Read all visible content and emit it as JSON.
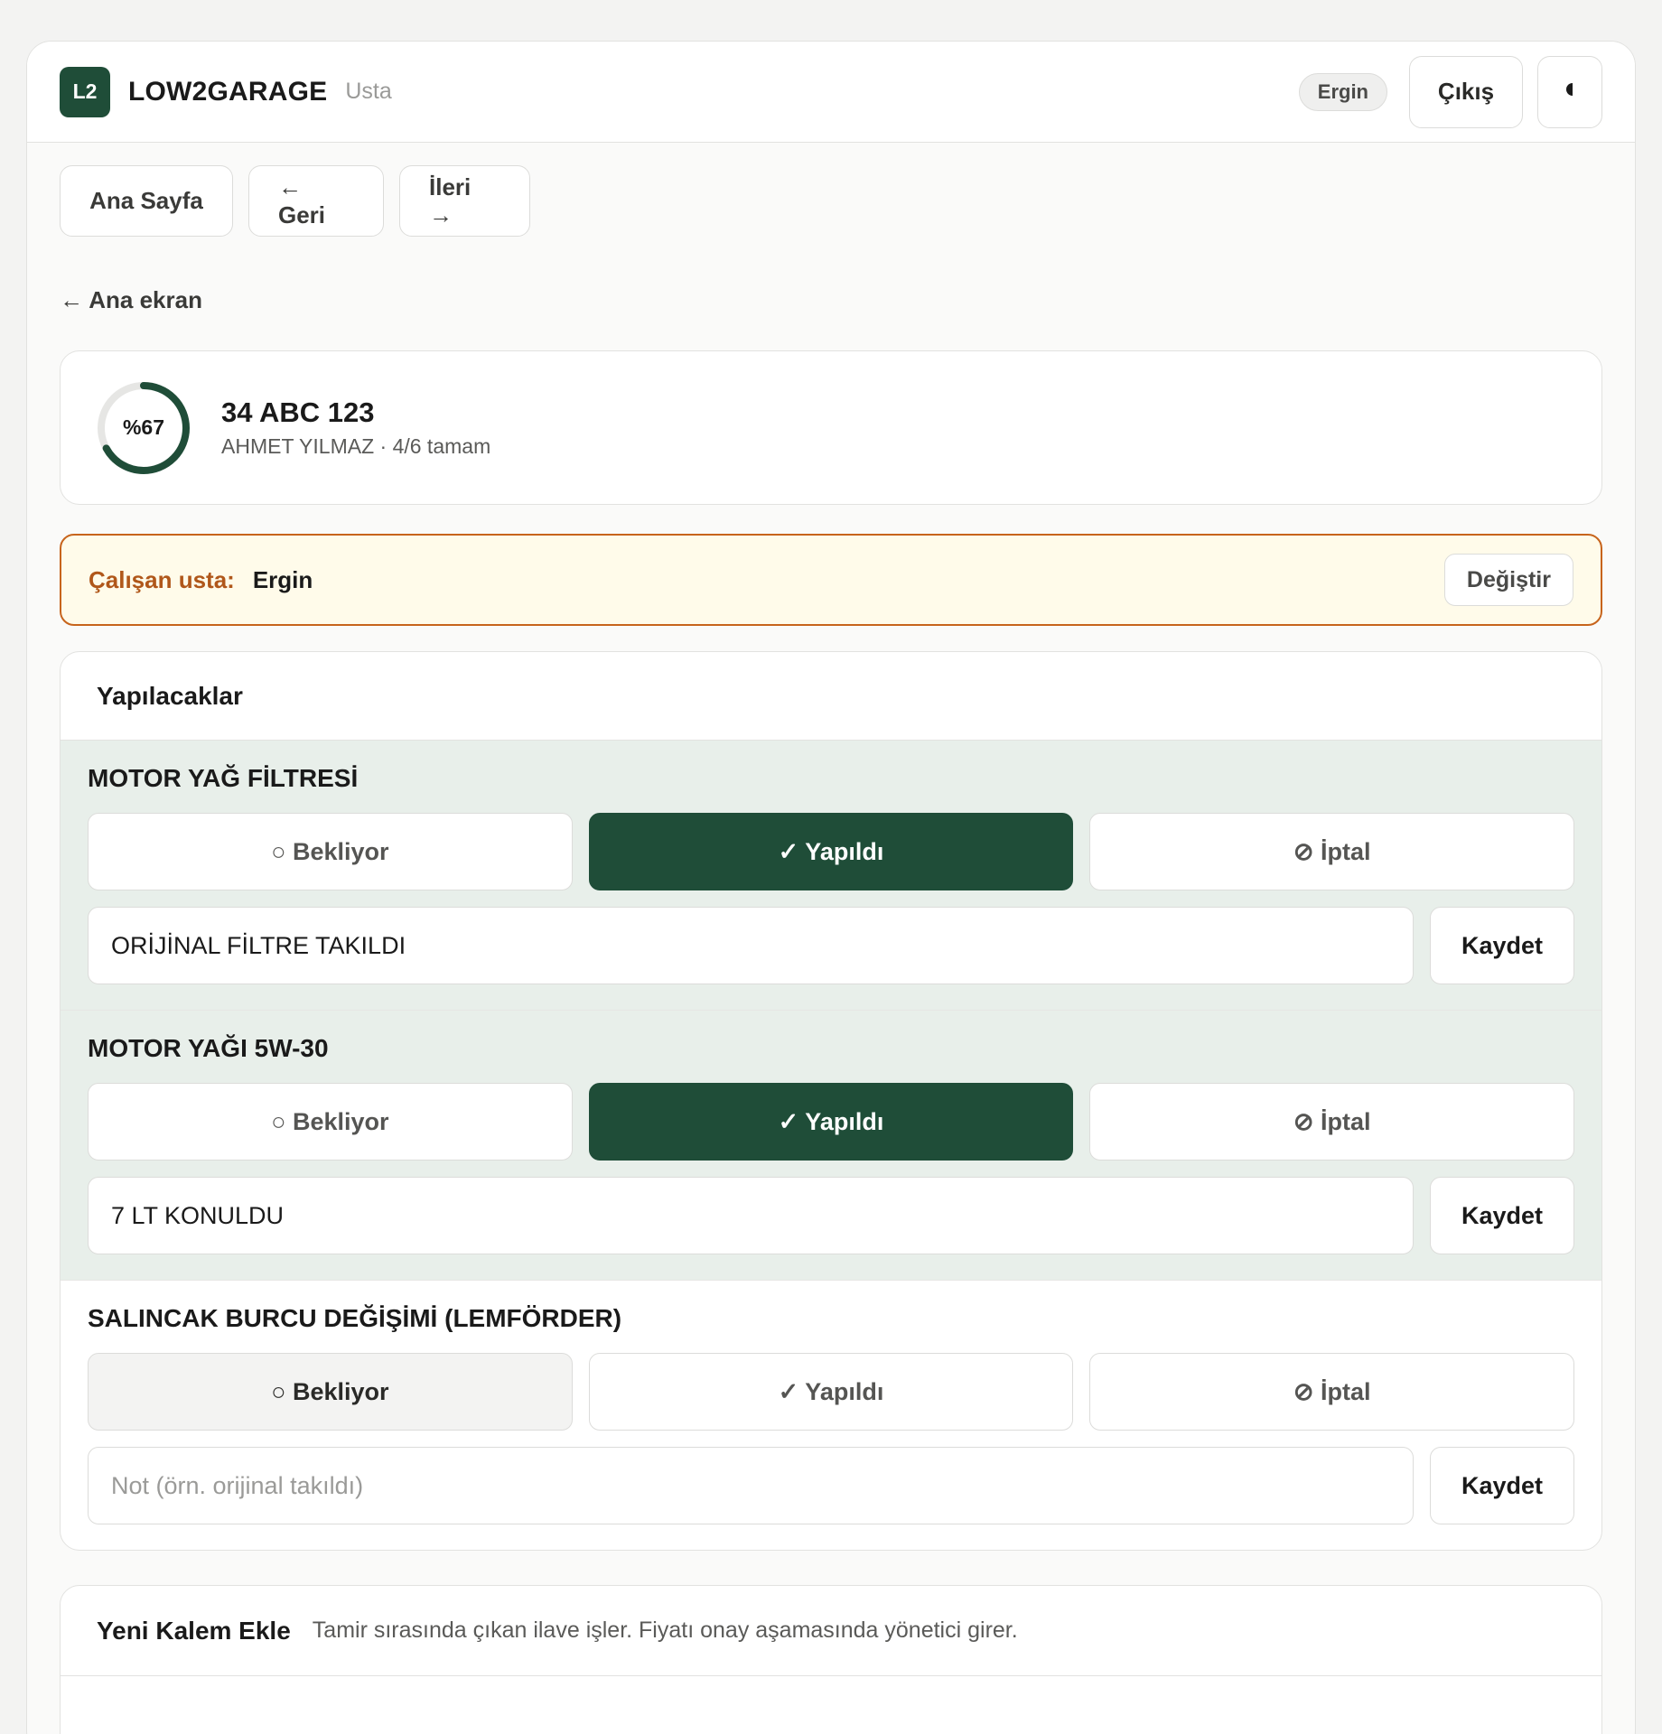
{
  "header": {
    "logo_text": "L2",
    "brand": "LOW2GARAGE",
    "role": "Usta",
    "user": "Ergin",
    "logout_label": "Çıkış",
    "theme_icon": "half-moon-icon"
  },
  "nav": {
    "home": "Ana Sayfa",
    "back": "← Geri",
    "forward": "İleri →"
  },
  "back_link": "← Ana ekran",
  "job": {
    "progress_text": "%67",
    "progress_fraction": 0.67,
    "plate": "34 ABC 123",
    "subtitle": "AHMET YILMAZ · 4/6 tamam"
  },
  "worker": {
    "label": "Çalışan usta:",
    "name": "Ergin",
    "change_label": "Değiştir"
  },
  "tasks": {
    "heading": "Yapılacaklar",
    "status_labels": {
      "pending": "○ Bekliyor",
      "done": "✓ Yapıldı",
      "cancel": "⊘ İptal"
    },
    "save_label": "Kaydet",
    "note_placeholder": "Not (örn. orijinal takıldı)",
    "items": [
      {
        "title": "MOTOR YAĞ FİLTRESİ",
        "status": "done",
        "note": "ORİJİNAL FİLTRE TAKILDI"
      },
      {
        "title": "MOTOR YAĞI 5W-30",
        "status": "done",
        "note": "7 LT KONULDU"
      },
      {
        "title": "SALINCAK BURCU DEĞİŞİMİ (LEMFÖRDER)",
        "status": "pending",
        "note": ""
      }
    ]
  },
  "new_item": {
    "title": "Yeni Kalem Ekle",
    "description": "Tamir sırasında çıkan ilave işler. Fiyatı onay aşamasında yönetici girer."
  },
  "colors": {
    "accent": "#1f4d38",
    "warning_border": "#c7641c",
    "warning_bg": "#fffbea",
    "done_row_bg": "#e8efea"
  }
}
